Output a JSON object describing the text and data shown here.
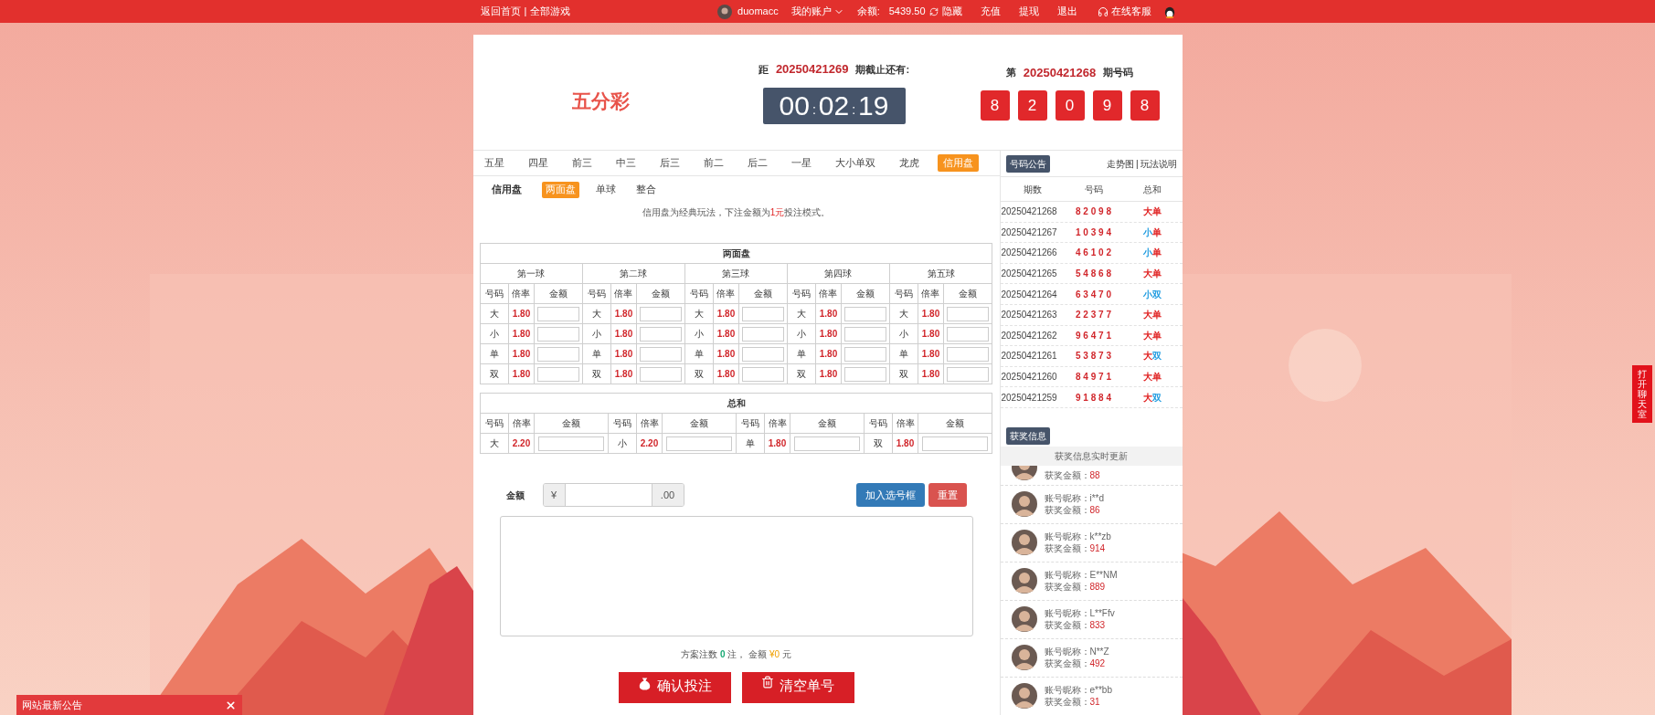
{
  "top_bar": {
    "links": [
      "返回首页",
      "全部游戏"
    ],
    "separator": "|",
    "username": "duomacc",
    "account_menu": "我的账户",
    "balance_label": "余额:",
    "balance": "5439.50",
    "hide": "隐藏",
    "actions": [
      "充值",
      "提现",
      "退出"
    ],
    "service": "在线客服"
  },
  "header": {
    "logo": "五分彩",
    "countdown": {
      "prefix": "距",
      "issue": "20250421269",
      "suffix": "期截止还有:",
      "time": [
        "00",
        "02",
        "19"
      ],
      "separator": ":"
    },
    "last_draw": {
      "prefix": "第",
      "issue": "20250421268",
      "suffix": "期号码",
      "balls": [
        "8",
        "2",
        "0",
        "9",
        "8"
      ]
    }
  },
  "play_tabs": [
    {
      "label": "五星",
      "selected": false
    },
    {
      "label": "四星",
      "selected": false
    },
    {
      "label": "前三",
      "selected": false
    },
    {
      "label": "中三",
      "selected": false
    },
    {
      "label": "后三",
      "selected": false
    },
    {
      "label": "前二",
      "selected": false
    },
    {
      "label": "后二",
      "selected": false
    },
    {
      "label": "一星",
      "selected": false
    },
    {
      "label": "大小单双",
      "selected": false
    },
    {
      "label": "龙虎",
      "selected": false
    },
    {
      "label": "信用盘",
      "selected": true
    }
  ],
  "sub_tabs": {
    "label": "信用盘",
    "items": [
      {
        "label": "两面盘",
        "selected": true
      },
      {
        "label": "单球",
        "selected": false
      },
      {
        "label": "整合",
        "selected": false
      }
    ]
  },
  "note": {
    "before": "信用盘为经典玩法，下注金额为",
    "highlight": "1元",
    "after": "投注模式。"
  },
  "two_sides": {
    "title": "两面盘",
    "balls": [
      {
        "name": "第一球",
        "headers": [
          "号码",
          "倍率",
          "金额"
        ],
        "rows": [
          {
            "code": "大",
            "odds": "1.80"
          },
          {
            "code": "小",
            "odds": "1.80"
          },
          {
            "code": "单",
            "odds": "1.80"
          },
          {
            "code": "双",
            "odds": "1.80"
          }
        ]
      },
      {
        "name": "第二球",
        "headers": [
          "号码",
          "倍率",
          "金额"
        ],
        "rows": [
          {
            "code": "大",
            "odds": "1.80"
          },
          {
            "code": "小",
            "odds": "1.80"
          },
          {
            "code": "单",
            "odds": "1.80"
          },
          {
            "code": "双",
            "odds": "1.80"
          }
        ]
      },
      {
        "name": "第三球",
        "headers": [
          "号码",
          "倍率",
          "金额"
        ],
        "rows": [
          {
            "code": "大",
            "odds": "1.80"
          },
          {
            "code": "小",
            "odds": "1.80"
          },
          {
            "code": "单",
            "odds": "1.80"
          },
          {
            "code": "双",
            "odds": "1.80"
          }
        ]
      },
      {
        "name": "第四球",
        "headers": [
          "号码",
          "倍率",
          "金额"
        ],
        "rows": [
          {
            "code": "大",
            "odds": "1.80"
          },
          {
            "code": "小",
            "odds": "1.80"
          },
          {
            "code": "单",
            "odds": "1.80"
          },
          {
            "code": "双",
            "odds": "1.80"
          }
        ]
      },
      {
        "name": "第五球",
        "headers": [
          "号码",
          "倍率",
          "金额"
        ],
        "rows": [
          {
            "code": "大",
            "odds": "1.80"
          },
          {
            "code": "小",
            "odds": "1.80"
          },
          {
            "code": "单",
            "odds": "1.80"
          },
          {
            "code": "双",
            "odds": "1.80"
          }
        ]
      }
    ]
  },
  "sum_table": {
    "title": "总和",
    "items": [
      {
        "headers": [
          "号码",
          "倍率",
          "金额"
        ],
        "code": "大",
        "odds": "2.20"
      },
      {
        "headers": [
          "号码",
          "倍率",
          "金额"
        ],
        "code": "小",
        "odds": "2.20"
      },
      {
        "headers": [
          "号码",
          "倍率",
          "金额"
        ],
        "code": "单",
        "odds": "1.80"
      },
      {
        "headers": [
          "号码",
          "倍率",
          "金额"
        ],
        "code": "双",
        "odds": "1.80"
      }
    ]
  },
  "amount": {
    "label": "金额",
    "prefix": "¥",
    "suffix": ".00",
    "buttons": [
      {
        "label": "加入选号框",
        "kind": "primary"
      },
      {
        "label": "重置",
        "kind": "danger"
      }
    ]
  },
  "summary": {
    "count_label": "方案注数",
    "count": "0",
    "count_unit": "注，",
    "amount_label": "金额",
    "amount": "¥0",
    "amount_unit": "元"
  },
  "actions": [
    {
      "label": "确认投注",
      "kind": "confirm"
    },
    {
      "label": "清空单号",
      "kind": "clear"
    }
  ],
  "results": {
    "title": "号码公告",
    "links": [
      "走势图",
      "玩法说明"
    ],
    "separator": "|",
    "columns": [
      "期数",
      "号码",
      "总和"
    ],
    "rows": [
      {
        "issue": "20250421268",
        "numbers": "8 2 0 9 8",
        "sum": [
          {
            "text": "大",
            "kind": "big"
          },
          {
            "text": "单",
            "kind": "odd"
          }
        ]
      },
      {
        "issue": "20250421267",
        "numbers": "1 0 3 9 4",
        "sum": [
          {
            "text": "小",
            "kind": "small"
          },
          {
            "text": "单",
            "kind": "odd"
          }
        ]
      },
      {
        "issue": "20250421266",
        "numbers": "4 6 1 0 2",
        "sum": [
          {
            "text": "小",
            "kind": "small"
          },
          {
            "text": "单",
            "kind": "odd"
          }
        ]
      },
      {
        "issue": "20250421265",
        "numbers": "5 4 8 6 8",
        "sum": [
          {
            "text": "大",
            "kind": "big"
          },
          {
            "text": "单",
            "kind": "odd"
          }
        ]
      },
      {
        "issue": "20250421264",
        "numbers": "6 3 4 7 0",
        "sum": [
          {
            "text": "小",
            "kind": "small"
          },
          {
            "text": "双",
            "kind": "even"
          }
        ]
      },
      {
        "issue": "20250421263",
        "numbers": "2 2 3 7 7",
        "sum": [
          {
            "text": "大",
            "kind": "big"
          },
          {
            "text": "单",
            "kind": "odd"
          }
        ]
      },
      {
        "issue": "20250421262",
        "numbers": "9 6 4 7 1",
        "sum": [
          {
            "text": "大",
            "kind": "big"
          },
          {
            "text": "单",
            "kind": "odd"
          }
        ]
      },
      {
        "issue": "20250421261",
        "numbers": "5 3 8 7 3",
        "sum": [
          {
            "text": "大",
            "kind": "big"
          },
          {
            "text": "双",
            "kind": "even"
          }
        ]
      },
      {
        "issue": "20250421260",
        "numbers": "8 4 9 7 1",
        "sum": [
          {
            "text": "大",
            "kind": "big"
          },
          {
            "text": "单",
            "kind": "odd"
          }
        ]
      },
      {
        "issue": "20250421259",
        "numbers": "9 1 8 8 4",
        "sum": [
          {
            "text": "大",
            "kind": "big"
          },
          {
            "text": "双",
            "kind": "even"
          }
        ]
      }
    ]
  },
  "winners": {
    "title": "获奖信息",
    "subtitle": "获奖信息实时更新",
    "items": [
      {
        "amount_label": "获奖金额：",
        "amount": "88"
      },
      {
        "name_label": "账号昵称：",
        "name": "i**d",
        "amount_label": "获奖金额：",
        "amount": "86"
      },
      {
        "name_label": "账号昵称：",
        "name": "k**zb",
        "amount_label": "获奖金额：",
        "amount": "914"
      },
      {
        "name_label": "账号昵称：",
        "name": "E**NM",
        "amount_label": "获奖金额：",
        "amount": "889"
      },
      {
        "name_label": "账号昵称：",
        "name": "L**Ffv",
        "amount_label": "获奖金额：",
        "amount": "833"
      },
      {
        "name_label": "账号昵称：",
        "name": "N**Z",
        "amount_label": "获奖金额：",
        "amount": "492"
      },
      {
        "name_label": "账号昵称：",
        "name": "e**bb",
        "amount_label": "获奖金额：",
        "amount": "31"
      }
    ]
  },
  "notice_bar": {
    "title": "网站最新公告"
  },
  "chat_tab": {
    "label": "打开聊天室"
  }
}
